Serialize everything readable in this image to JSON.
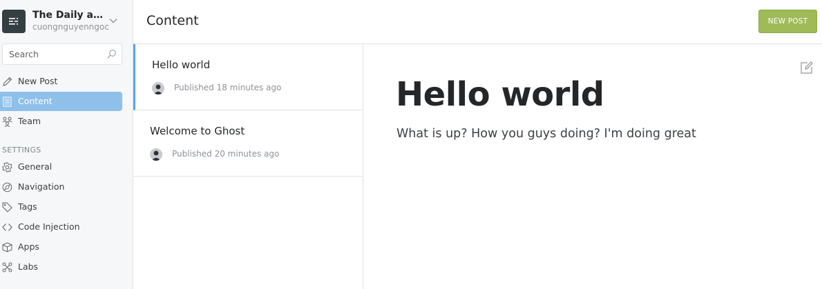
{
  "sidebar": {
    "blog_title": "The Daily aw...",
    "blog_user": "cuongnguyenngoc",
    "search_placeholder": "Search",
    "nav": [
      {
        "label": "New Post",
        "icon": "pencil-icon"
      },
      {
        "label": "Content",
        "icon": "document-icon",
        "active": true
      },
      {
        "label": "Team",
        "icon": "team-icon"
      }
    ],
    "settings_heading": "SETTINGS",
    "settings": [
      {
        "label": "General",
        "icon": "gear-icon"
      },
      {
        "label": "Navigation",
        "icon": "compass-icon"
      },
      {
        "label": "Tags",
        "icon": "tag-icon"
      },
      {
        "label": "Code Injection",
        "icon": "code-icon"
      },
      {
        "label": "Apps",
        "icon": "box-icon"
      },
      {
        "label": "Labs",
        "icon": "labs-icon"
      }
    ]
  },
  "header": {
    "title": "Content",
    "new_post_label": "NEW POST"
  },
  "posts": [
    {
      "title": "Hello world",
      "meta": "Published 18 minutes ago",
      "selected": true
    },
    {
      "title": "Welcome to Ghost",
      "meta": "Published 20 minutes ago",
      "selected": false
    }
  ],
  "preview": {
    "title": "Hello world",
    "body": "What is up? How you guys doing? I'm doing great"
  },
  "colors": {
    "accent": "#9fbb58",
    "active_nav": "#8ec0ea",
    "selected_border": "#5ba4e5",
    "sidebar_bg": "#f6f7f8"
  }
}
